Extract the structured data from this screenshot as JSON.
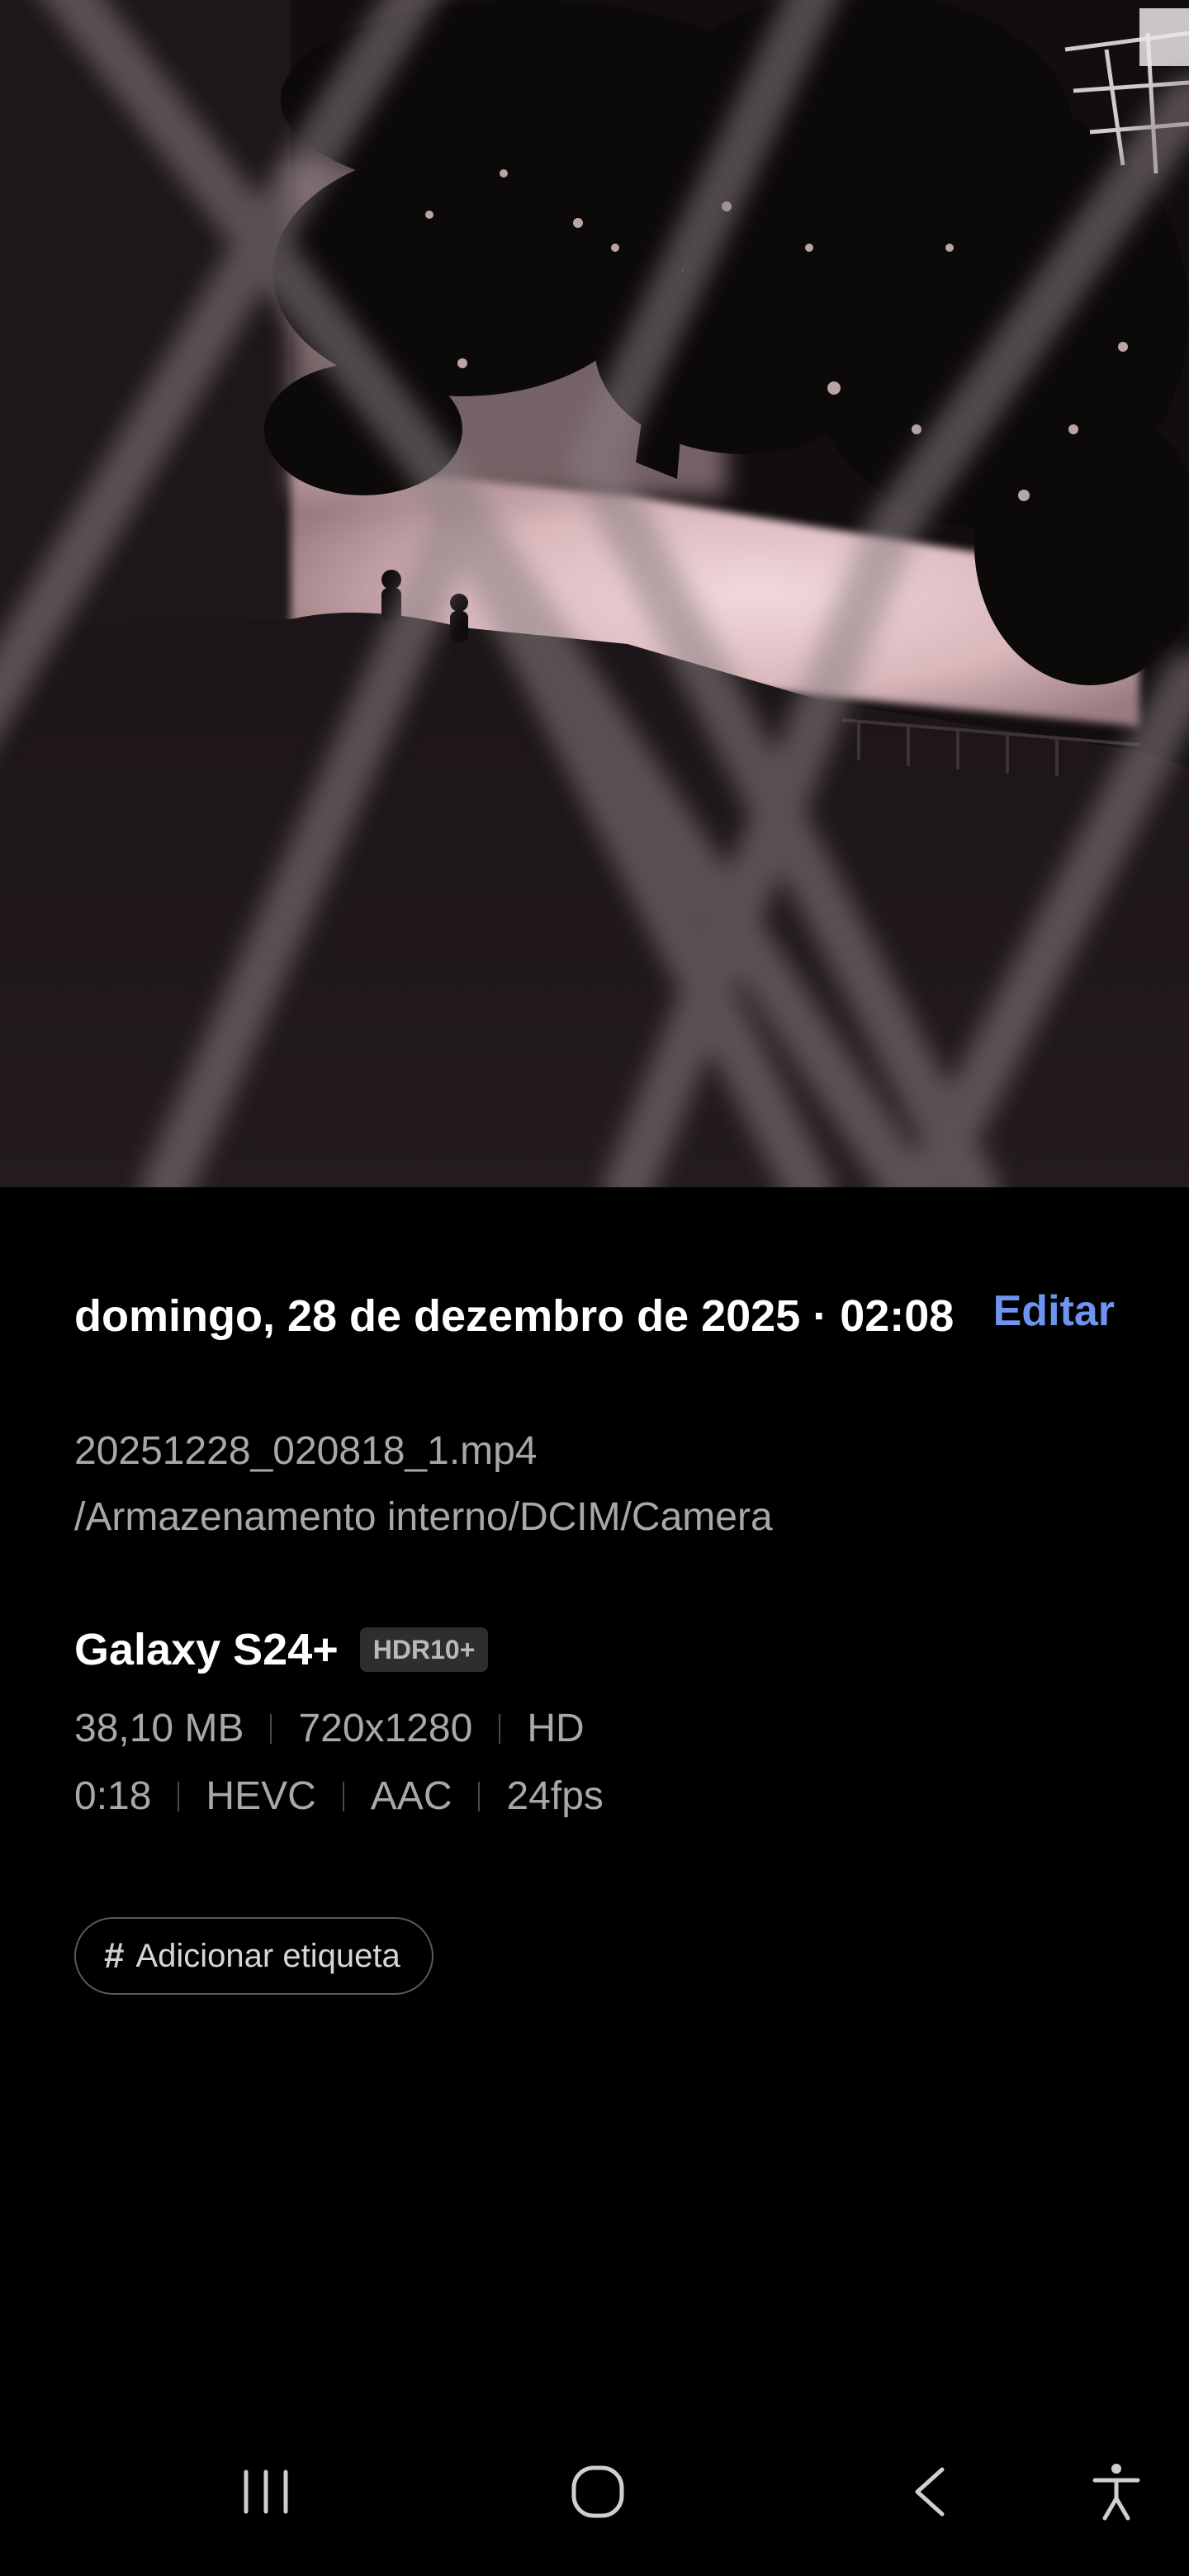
{
  "photo": {
    "description_icon": "night-scene-image"
  },
  "details": {
    "date_time": "domingo, 28 de dezembro de 2025 · 02:08",
    "edit_label": "Editar",
    "file_name": "20251228_020818_1.mp4",
    "file_path": "/Armazenamento interno/DCIM/Camera",
    "device": "Galaxy S24+",
    "hdr_badge": "HDR10+",
    "specs_row1": [
      "38,10 MB",
      "720x1280",
      "HD"
    ],
    "specs_row2": [
      "0:18",
      "HEVC",
      "AAC",
      "24fps"
    ],
    "tag_button": {
      "icon": "#",
      "label": "Adicionar etiqueta"
    }
  },
  "navbar": {
    "recents_icon": "recents-icon",
    "home_icon": "home-icon",
    "back_icon": "back-icon",
    "accessibility_icon": "accessibility-icon"
  },
  "colors": {
    "accent": "#6f93f0",
    "background": "#000000",
    "secondary_text": "#a8a8a8"
  }
}
